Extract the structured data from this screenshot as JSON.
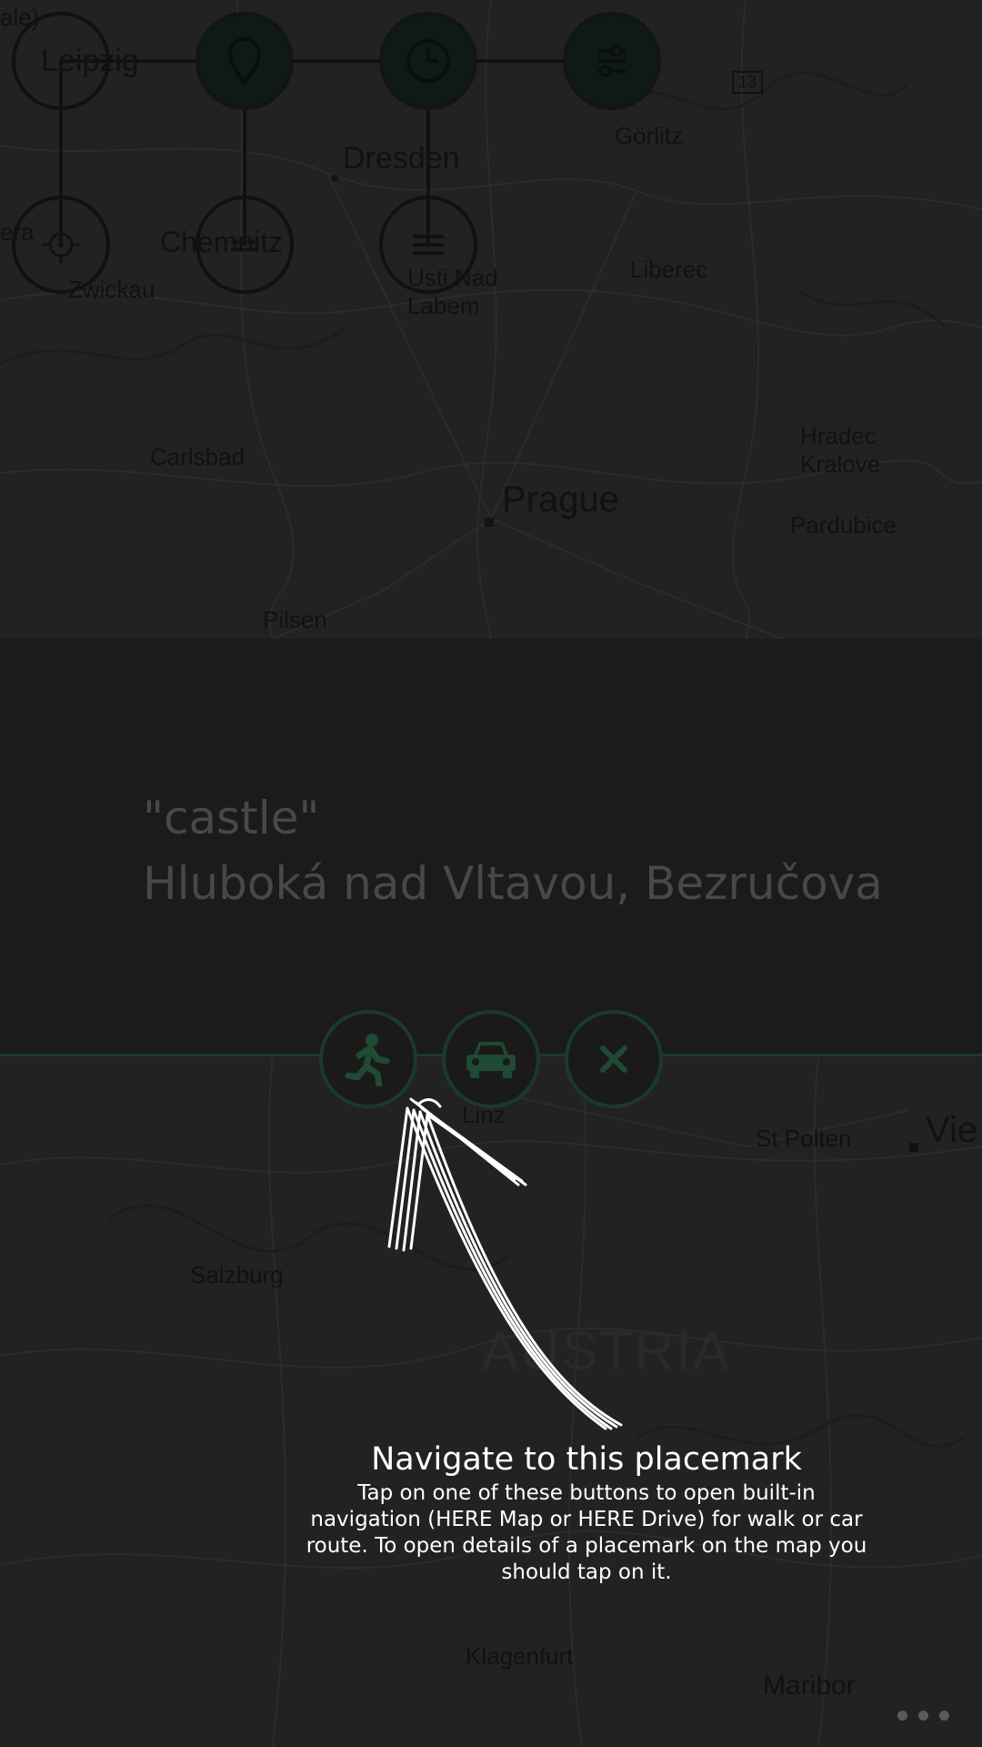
{
  "map_top": {
    "cities": [
      {
        "name": "Leipzig"
      },
      {
        "name": "Dresden"
      },
      {
        "name": "Görlitz"
      },
      {
        "name": "Chemnitz"
      },
      {
        "name": "Zwickau"
      },
      {
        "name": "Usti Nad"
      },
      {
        "name": "Labem"
      },
      {
        "name": "Liberec"
      },
      {
        "name": "Hradec"
      },
      {
        "name": "Kralove"
      },
      {
        "name": "Carlsbad"
      },
      {
        "name": "Prague"
      },
      {
        "name": "Pardubice"
      },
      {
        "name": "Pilsen"
      },
      {
        "name": "era"
      },
      {
        "name": "ale)"
      }
    ],
    "road_sign": "13"
  },
  "map_bottom": {
    "cities": [
      {
        "name": "Linz"
      },
      {
        "name": "St Polten"
      },
      {
        "name": "Vie"
      },
      {
        "name": "Salzburg"
      },
      {
        "name": "AUSTRIA"
      },
      {
        "name": "Klagenfurt"
      },
      {
        "name": "Maribor"
      }
    ]
  },
  "top_menu": {
    "buttons": [
      {
        "icon": "pin-icon"
      },
      {
        "icon": "clock-icon"
      },
      {
        "icon": "settings-icon"
      },
      {
        "icon": "locate-icon"
      },
      {
        "icon": "list-icon"
      }
    ]
  },
  "placemark": {
    "query": "\"castle\"",
    "address": "Hluboká nad Vltavou, Bezručova"
  },
  "actions": [
    {
      "icon": "walk-icon"
    },
    {
      "icon": "car-icon"
    },
    {
      "icon": "close-icon"
    }
  ],
  "hint": {
    "title": "Navigate to this placemark",
    "body": "Tap on one of these buttons to open built-in navigation (HERE Map or HERE Drive) for walk or car route. To open details of a placemark on the map you should tap on it."
  },
  "colors": {
    "accent": "#1b3a29",
    "accent_icon": "#1f4a33",
    "panel": "#1b1b1b",
    "map": "#222222"
  }
}
